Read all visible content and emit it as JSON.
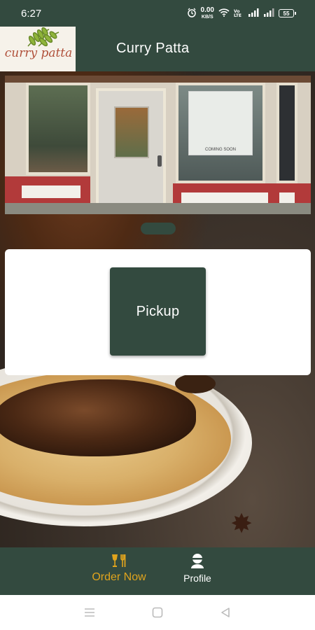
{
  "status_bar": {
    "time": "6:27",
    "data_speed_value": "0.00",
    "data_speed_unit": "KB/S",
    "battery": "55",
    "icons": [
      "alarm-icon",
      "wifi-icon",
      "volte-icon",
      "signal-icon",
      "signal-icon",
      "battery-icon"
    ]
  },
  "app_bar": {
    "logo_text": "curry patta",
    "title": "Curry Patta"
  },
  "storefront": {
    "sign_text": "COMING SOON"
  },
  "pickup": {
    "label": "Pickup"
  },
  "bottom_nav": {
    "items": [
      {
        "label": "Order Now",
        "icon": "fork-knife-icon",
        "active": true
      },
      {
        "label": "Profile",
        "icon": "profile-icon",
        "active": false
      }
    ]
  },
  "colors": {
    "primary": "#334a3f",
    "accent": "#e0a41d",
    "surface": "#ffffff"
  }
}
